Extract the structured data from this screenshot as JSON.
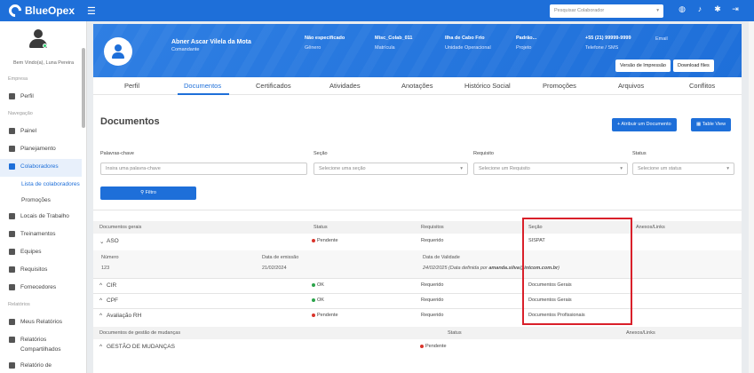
{
  "app": {
    "name": "BlueOpex"
  },
  "topbar": {
    "search_placeholder": "Pesquisar Colaborador"
  },
  "sidebar": {
    "welcome": "Bem Vindo(a), Luna Pereira",
    "section_empresa": "Empresa",
    "perfil": "Perfil",
    "section_navegacao": "Navegação",
    "painel": "Painel",
    "planejamento": "Planejamento",
    "colaboradores": "Colaboradores",
    "lista": "Lista de colaboradores",
    "promocoes": "Promoções",
    "locais": "Locais de Trabalho",
    "treinamentos": "Treinamentos",
    "equipes": "Equipes",
    "requisitos": "Requisitos",
    "fornecedores": "Fornecedores",
    "section_relatorios": "Relatórios",
    "meus_relatorios": "Meus Relatórios",
    "relatorios_compartilhados_1": "Relatórios",
    "relatorios_compartilhados_2": "Compartilhados",
    "relatorio_de": "Relatório de"
  },
  "profile": {
    "name": "Abner Ascar Vilela da Mota",
    "role": "Comandante",
    "genero_val": "Não especificado",
    "genero_lab": "Gênero",
    "matricula_val": "Misc_Colab_011",
    "matricula_lab": "Matrícula",
    "unidade_val": "Ilha de Cabo Frio",
    "unidade_lab": "Unidade Operacional",
    "projeto_val": "Padrão...",
    "projeto_lab": "Projeto",
    "telefone_val": "+55 (21) 99999-9999",
    "telefone_lab": "Telefone / SMS",
    "email_lab": "Email",
    "btn_print": "Versão de Impressão",
    "btn_download": "Download files"
  },
  "tabs": [
    "Perfil",
    "Documentos",
    "Certificados",
    "Atividades",
    "Anotações",
    "Histórico Social",
    "Promoções",
    "Arquivos",
    "Conflitos"
  ],
  "documents": {
    "title": "Documentos",
    "btn_add": "+ Atribuir um Documento",
    "btn_table": "Table View",
    "filters": {
      "keyword_label": "Palavras-chave",
      "keyword_placeholder": "Insira uma palavra-chave",
      "section_label": "Seção",
      "section_placeholder": "Selecione uma seção",
      "req_label": "Requisito",
      "req_placeholder": "Selecione um Requisito",
      "status_label": "Status",
      "status_placeholder": "Selecione um status",
      "filter_btn": "Filtro"
    },
    "table": {
      "h_docs": "Documentos gerais",
      "h_status": "Status",
      "h_req": "Requisitos",
      "h_sec": "Seção",
      "h_anexos": "Anexos/Links",
      "rows": [
        {
          "name": "ASO",
          "status": "Pendente",
          "req": "Requerido",
          "sec": "SISPAT"
        },
        {
          "name": "CIR",
          "status": "OK",
          "req": "Requerido",
          "sec": "Documentos Gerais"
        },
        {
          "name": "CPF",
          "status": "OK",
          "req": "Requerido",
          "sec": "Documentos Gerais"
        },
        {
          "name": "Avaliação RH",
          "status": "Pendente",
          "req": "Requerido",
          "sec": "Documentos Profissionais"
        }
      ],
      "detail": {
        "numero_lab": "Número",
        "numero_val": "123",
        "emissao_lab": "Data de emissão",
        "emissao_val": "21/02/2024",
        "validade_lab": "Data de Validade",
        "validade_val": "24/02/2025 (Data definida por ",
        "validade_user": "amanda.silva@intcom.com.br",
        "validade_end": ")"
      },
      "h2_docs": "Documentos de gestão de mudanças",
      "h2_status": "Status",
      "h2_anexos": "Anexos/Links",
      "row2": {
        "name": "GESTÃO DE MUDANÇAS",
        "status": "Pendente"
      }
    }
  },
  "colors": {
    "brand": "#1e6fd9",
    "highlight": "#d9202a",
    "ok": "#2ca44b",
    "pending": "#d9342b"
  }
}
